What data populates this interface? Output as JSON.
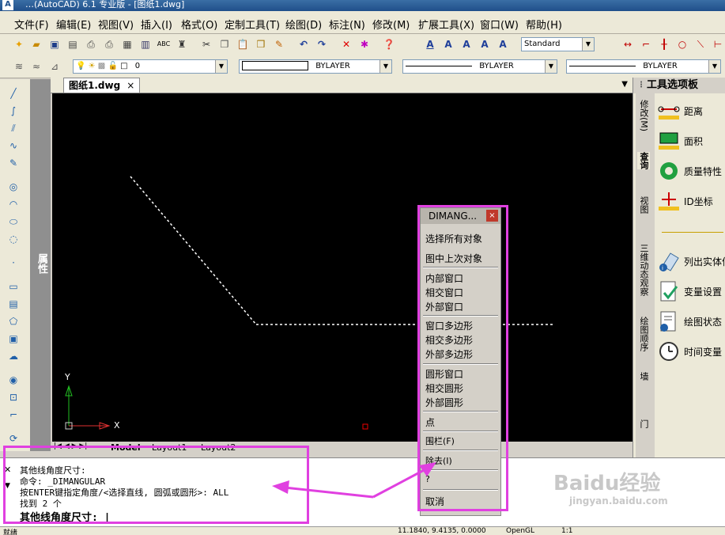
{
  "window": {
    "title_text": "…(AutoCAD) 6.1 专业版 - [图纸1.dwg]",
    "logo": "A"
  },
  "menu": [
    "文件(F)",
    "编辑(E)",
    "视图(V)",
    "插入(I)",
    "格式(O)",
    "定制工具(T)",
    "绘图(D)",
    "标注(N)",
    "修改(M)",
    "扩展工具(X)",
    "窗口(W)",
    "帮助(H)"
  ],
  "toolbar": {
    "text_style": "Standard",
    "layer_value": "0",
    "color_value": "BYLAYER",
    "linetype_value": "BYLAYER",
    "lineweight_value": "BYLAYER"
  },
  "properties_bar": {
    "label": "属性"
  },
  "document_tab": {
    "label": "图纸1.dwg",
    "close": "×"
  },
  "layout_tabs": [
    "Model",
    "Layout1",
    "Layout2"
  ],
  "canvas": {
    "axis_x": "X",
    "axis_y": "Y"
  },
  "tool_palette": {
    "title": "工具选项板",
    "vertical_tabs": [
      "修改(M)",
      "查询",
      "视图",
      "三维动态观察",
      "绘图顺序",
      "墙",
      "门"
    ],
    "tools": [
      {
        "label": "距离",
        "icon": "distance-icon"
      },
      {
        "label": "面积",
        "icon": "area-icon"
      },
      {
        "label": "质量特性",
        "icon": "mass-properties-icon"
      },
      {
        "label": "ID坐标",
        "icon": "id-point-icon"
      },
      {
        "label": "列出实体信",
        "icon": "list-icon"
      },
      {
        "label": "变量设置",
        "icon": "setvar-icon"
      },
      {
        "label": "绘图状态",
        "icon": "status-icon"
      },
      {
        "label": "时间变量",
        "icon": "time-icon"
      }
    ]
  },
  "context_menu": {
    "title": "DIMANG...",
    "close": "×",
    "items": [
      [
        "选择所有对象",
        "图中上次对象"
      ],
      [
        "内部窗口",
        "相交窗口",
        "外部窗口"
      ],
      [
        "窗口多边形",
        "相交多边形",
        "外部多边形"
      ],
      [
        "圆形窗口",
        "相交圆形",
        "外部圆形"
      ],
      [
        "点"
      ],
      [
        "围栏(F)"
      ],
      [
        "除去(I)"
      ],
      [
        "?"
      ],
      [
        "取消"
      ]
    ]
  },
  "command": {
    "lines": [
      "其他线角度尺寸:",
      "命令:  _DIMANGULAR",
      "按ENTER键指定角度/<选择直线, 圆弧或圆形>: ALL",
      "找到 2 个"
    ],
    "prompt": "其他线角度尺寸: |"
  },
  "status": {
    "left": "就绪",
    "coords": "11.1840, 9.4135, 0.0000",
    "opengl": "OpenGL",
    "scale": "1:1"
  },
  "watermark": {
    "main": "Baidu经验",
    "sub": "jingyan.baidu.com"
  },
  "colors": {
    "highlight": "#e040e0",
    "canvas": "#000000"
  }
}
